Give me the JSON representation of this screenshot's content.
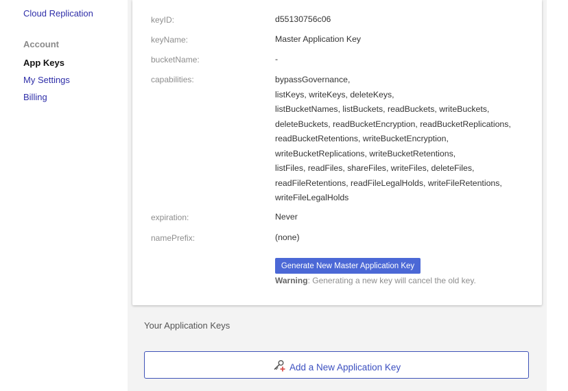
{
  "sidebar": {
    "cloud_replication": "Cloud Replication",
    "account_header": "Account",
    "app_keys": "App Keys",
    "my_settings": "My Settings",
    "billing": "Billing"
  },
  "master_key": {
    "keyid_label": "keyID:",
    "keyid_value": "d55130756c06",
    "keyname_label": "keyName:",
    "keyname_value": "Master Application Key",
    "bucketname_label": "bucketName:",
    "bucketname_value": "-",
    "capabilities_label": "capabilities:",
    "capabilities_lines": [
      "bypassGovernance,",
      "listKeys, writeKeys, deleteKeys,",
      "listBucketNames, listBuckets, readBuckets, writeBuckets,",
      "deleteBuckets, readBucketEncryption, readBucketReplications,",
      "readBucketRetentions, writeBucketEncryption,",
      "writeBucketReplications, writeBucketRetentions,",
      "listFiles, readFiles, shareFiles, writeFiles, deleteFiles,",
      "readFileRetentions, readFileLegalHolds, writeFileRetentions,",
      "writeFileLegalHolds"
    ],
    "expiration_label": "expiration:",
    "expiration_value": "Never",
    "nameprefix_label": "namePrefix:",
    "nameprefix_value": "(none)",
    "generate_button": "Generate New Master Application Key",
    "warning_bold": "Warning",
    "warning_text": ": Generating a new key will cancel the old key."
  },
  "app_keys_section": {
    "title": "Your Application Keys",
    "add_button": "Add a New Application Key",
    "add_icon": "key-plus-icon",
    "icon_colors": {
      "key": "#555555",
      "plus": "#d9534f"
    }
  }
}
